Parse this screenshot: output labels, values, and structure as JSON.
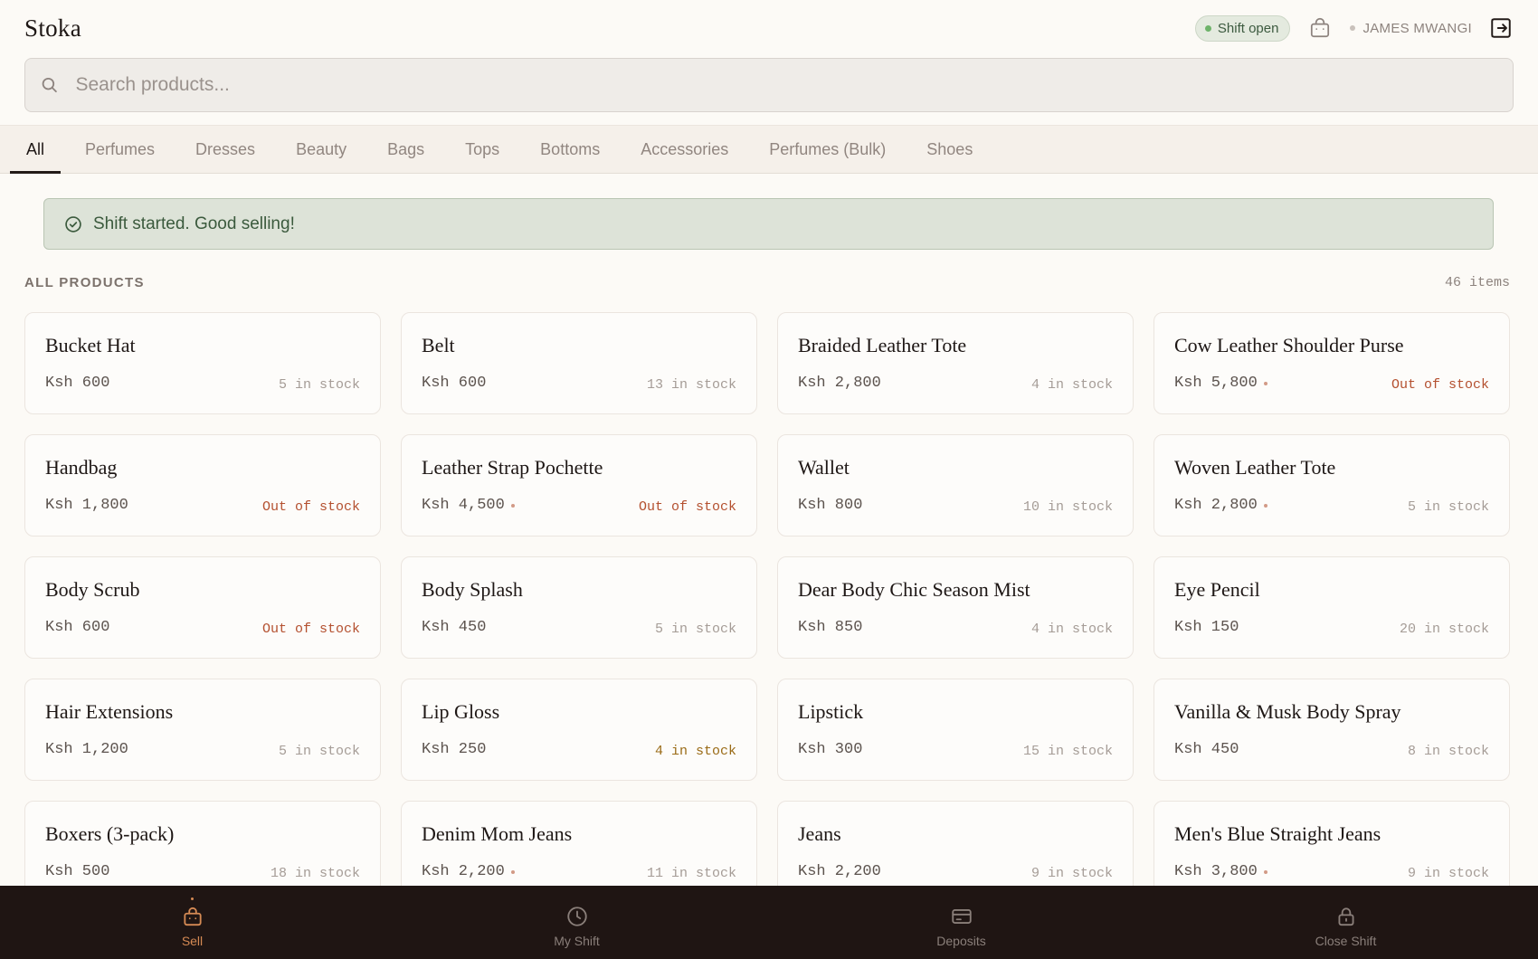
{
  "app": {
    "brand": "Stoka"
  },
  "header": {
    "shift_status": "Shift open",
    "user_name": "JAMES MWANGI"
  },
  "search": {
    "placeholder": "Search products..."
  },
  "tabs": [
    {
      "label": "All",
      "active": true
    },
    {
      "label": "Perfumes"
    },
    {
      "label": "Dresses"
    },
    {
      "label": "Beauty"
    },
    {
      "label": "Bags"
    },
    {
      "label": "Tops"
    },
    {
      "label": "Bottoms"
    },
    {
      "label": "Accessories"
    },
    {
      "label": "Perfumes (Bulk)"
    },
    {
      "label": "Shoes"
    }
  ],
  "banner": {
    "message": "Shift started. Good selling!"
  },
  "section": {
    "title": "ALL PRODUCTS",
    "count": "46 items"
  },
  "products": [
    {
      "name": "Bucket Hat",
      "price": "Ksh 600",
      "stock": "5 in stock",
      "status": "ok",
      "marked": false
    },
    {
      "name": "Belt",
      "price": "Ksh 600",
      "stock": "13 in stock",
      "status": "ok",
      "marked": false
    },
    {
      "name": "Braided Leather Tote",
      "price": "Ksh 2,800",
      "stock": "4 in stock",
      "status": "ok",
      "marked": false
    },
    {
      "name": "Cow Leather Shoulder Purse",
      "price": "Ksh 5,800",
      "stock": "Out of stock",
      "status": "out",
      "marked": true
    },
    {
      "name": "Handbag",
      "price": "Ksh 1,800",
      "stock": "Out of stock",
      "status": "out",
      "marked": false
    },
    {
      "name": "Leather Strap Pochette",
      "price": "Ksh 4,500",
      "stock": "Out of stock",
      "status": "out",
      "marked": true
    },
    {
      "name": "Wallet",
      "price": "Ksh 800",
      "stock": "10 in stock",
      "status": "ok",
      "marked": false
    },
    {
      "name": "Woven Leather Tote",
      "price": "Ksh 2,800",
      "stock": "5 in stock",
      "status": "ok",
      "marked": true
    },
    {
      "name": "Body Scrub",
      "price": "Ksh 600",
      "stock": "Out of stock",
      "status": "out",
      "marked": false
    },
    {
      "name": "Body Splash",
      "price": "Ksh 450",
      "stock": "5 in stock",
      "status": "ok",
      "marked": false
    },
    {
      "name": "Dear Body Chic Season Mist",
      "price": "Ksh 850",
      "stock": "4 in stock",
      "status": "ok",
      "marked": false
    },
    {
      "name": "Eye Pencil",
      "price": "Ksh 150",
      "stock": "20 in stock",
      "status": "ok",
      "marked": false
    },
    {
      "name": "Hair Extensions",
      "price": "Ksh 1,200",
      "stock": "5 in stock",
      "status": "ok",
      "marked": false
    },
    {
      "name": "Lip Gloss",
      "price": "Ksh 250",
      "stock": "4 in stock",
      "status": "low",
      "marked": false
    },
    {
      "name": "Lipstick",
      "price": "Ksh 300",
      "stock": "15 in stock",
      "status": "ok",
      "marked": false
    },
    {
      "name": "Vanilla & Musk Body Spray",
      "price": "Ksh 450",
      "stock": "8 in stock",
      "status": "ok",
      "marked": false
    },
    {
      "name": "Boxers (3-pack)",
      "price": "Ksh 500",
      "stock": "18 in stock",
      "status": "ok",
      "marked": false
    },
    {
      "name": "Denim Mom Jeans",
      "price": "Ksh 2,200",
      "stock": "11 in stock",
      "status": "ok",
      "marked": true
    },
    {
      "name": "Jeans",
      "price": "Ksh 2,200",
      "stock": "9 in stock",
      "status": "ok",
      "marked": false
    },
    {
      "name": "Men's Blue Straight Jeans",
      "price": "Ksh 3,800",
      "stock": "9 in stock",
      "status": "ok",
      "marked": true
    }
  ],
  "bottom_nav": [
    {
      "label": "Sell",
      "icon": "bag-icon",
      "active": true
    },
    {
      "label": "My Shift",
      "icon": "clock-icon"
    },
    {
      "label": "Deposits",
      "icon": "card-icon"
    },
    {
      "label": "Close Shift",
      "icon": "lock-icon"
    }
  ],
  "colors": {
    "accent": "#d58a54",
    "success": "#3b5a3d",
    "out_of_stock": "#b4502f",
    "low_stock": "#9a6b16"
  }
}
